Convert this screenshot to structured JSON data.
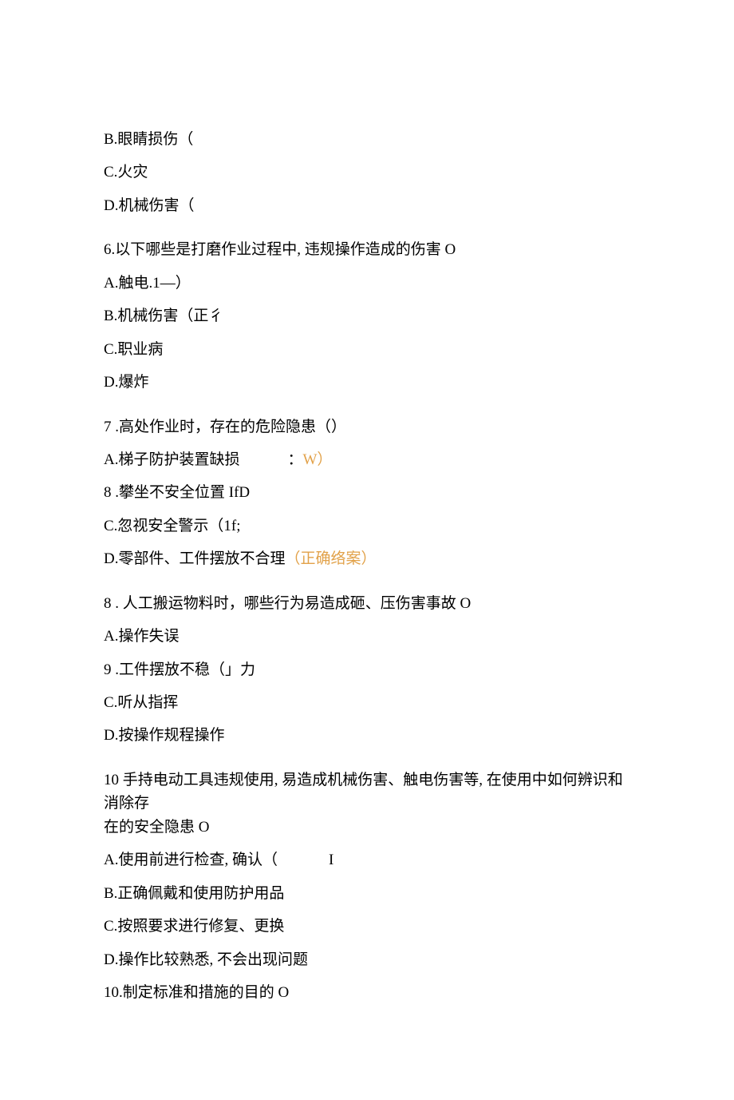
{
  "q5": {
    "optB": "B.眼睛损伤（",
    "optC": "C.火灾",
    "optD": "D.机械伤害（"
  },
  "q6": {
    "stem": "6.以下哪些是打磨作业过程中, 违规操作造成的伤害 O",
    "optA": "A.触电.1—）",
    "optB": "B.机械伤害（正彳",
    "optC": "C.职业病",
    "optD": "D.爆炸"
  },
  "q7": {
    "stem": "7 .高处作业时，存在的危险隐患（）",
    "optA_prefix": "A.梯子防护装置缺损",
    "optA_sep": "：",
    "optA_suffix": "W）",
    "optB": "8  .攀坐不安全位置 IfD",
    "optC": "C.忽视安全警示（1f;",
    "optD_prefix": "D.零部件、工件摆放不合理",
    "optD_suffix": "（正确络案）"
  },
  "q8": {
    "stem": "8 . 人工搬运物料时，哪些行为易造成砸、压伤害事故 O",
    "optA": "A.操作失误",
    "optB": "9  .工件摆放不稳（」力",
    "optC": "C.听从指挥",
    "optD": "D.按操作规程操作"
  },
  "q10": {
    "stem_line1": "10 手持电动工具违规使用, 易造成机械伤害、触电伤害等, 在使用中如何辨识和消除存",
    "stem_line2": "在的安全隐患 O",
    "optA_prefix": "A.使用前进行检查, 确认（",
    "optA_suffix": "I",
    "optB": "B.正确佩戴和使用防护用品",
    "optC": "C.按照要求进行修复、更换",
    "optD": "D.操作比较熟悉, 不会出现问题"
  },
  "q10b": {
    "stem": "10.制定标准和措施的目的 O"
  }
}
